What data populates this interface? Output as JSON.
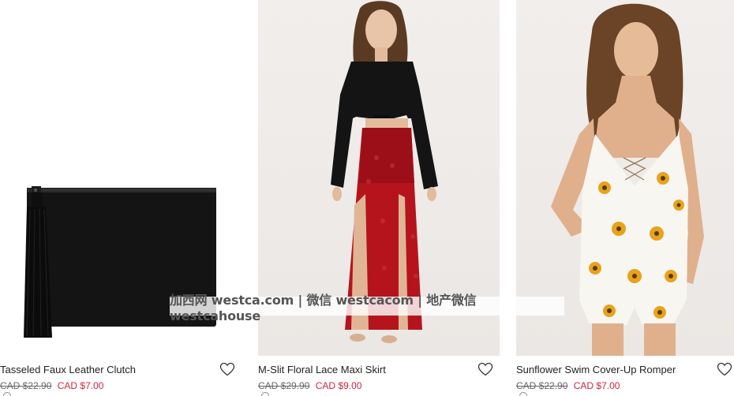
{
  "products": [
    {
      "title": "Tasseled Faux Leather Clutch",
      "original_price": "CAD $22.90",
      "sale_price": "CAD $7.00",
      "image": "black-clutch-with-tassel",
      "icon": "heart-outline"
    },
    {
      "title": "M-Slit Floral Lace Maxi Skirt",
      "original_price": "CAD $29.90",
      "sale_price": "CAD $9.00",
      "image": "model-red-lace-maxi-skirt",
      "icon": "heart-outline"
    },
    {
      "title": "Sunflower Swim Cover-Up Romper",
      "original_price": "CAD $22.90",
      "sale_price": "CAD $7.00",
      "image": "model-sunflower-romper",
      "icon": "heart-outline"
    }
  ],
  "watermark": "加西网 westca.com | 微信 westcacom | 地产微信 westcahouse",
  "colors": {
    "sale_price": "#d0253e",
    "text": "#222222",
    "strike_price": "#666666"
  }
}
